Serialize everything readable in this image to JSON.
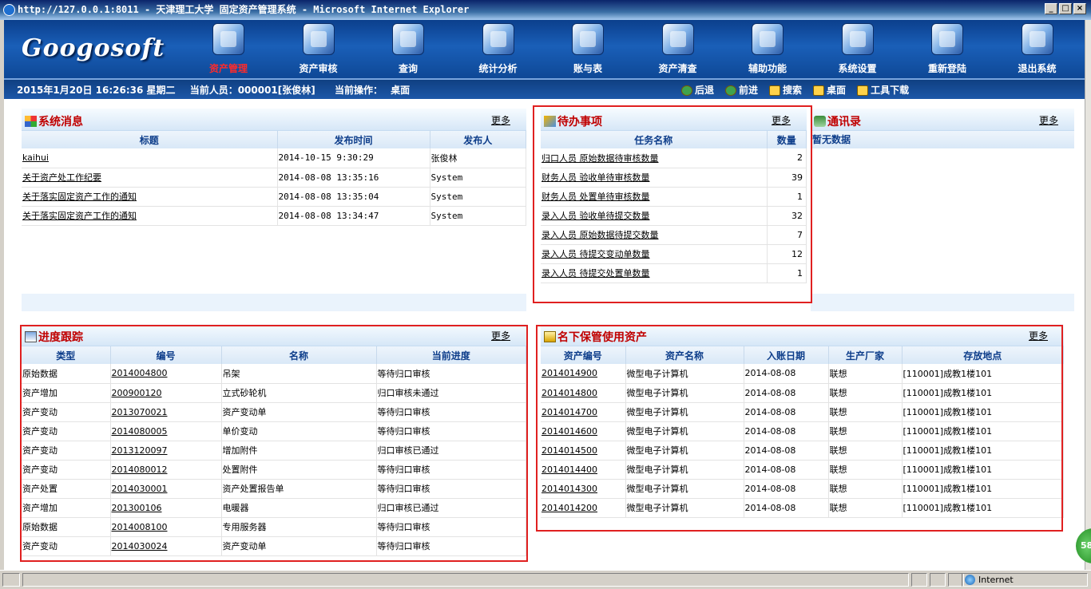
{
  "window": {
    "title": "http://127.0.0.1:8011 - 天津理工大学 固定资产管理系统 - Microsoft Internet Explorer",
    "controls": [
      "_",
      "□",
      "×"
    ]
  },
  "header": {
    "logo": "Googosoft",
    "nav": [
      {
        "label": "资产管理",
        "icon": "asset-management-icon",
        "active": true
      },
      {
        "label": "资产审核",
        "icon": "asset-audit-icon"
      },
      {
        "label": "查询",
        "icon": "query-icon"
      },
      {
        "label": "统计分析",
        "icon": "statistics-icon"
      },
      {
        "label": "账与表",
        "icon": "ledger-icon"
      },
      {
        "label": "资产清查",
        "icon": "inventory-check-icon"
      },
      {
        "label": "辅助功能",
        "icon": "auxiliary-icon"
      },
      {
        "label": "系统设置",
        "icon": "system-settings-icon"
      },
      {
        "label": "重新登陆",
        "icon": "relogin-icon"
      },
      {
        "label": "退出系统",
        "icon": "exit-icon"
      }
    ]
  },
  "status": {
    "datetime": "2015年1月20日 16:26:36 星期二",
    "user_label": "当前人员：000001[张俊林]",
    "op_label": "当前操作：",
    "op_value": "桌面",
    "tools": [
      "后退",
      "前进",
      "搜索",
      "桌面",
      "工具下载"
    ]
  },
  "messages": {
    "title": "系统消息",
    "more": "更多",
    "columns": [
      "标题",
      "发布时间",
      "发布人"
    ],
    "rows": [
      [
        "kaihui",
        "2014-10-15 9:30:29",
        "张俊林"
      ],
      [
        "关于资产处工作纪要",
        "2014-08-08 13:35:16",
        "System"
      ],
      [
        "关于落实固定资产工作的通知",
        "2014-08-08 13:35:04",
        "System"
      ],
      [
        "关于落实固定资产工作的通知",
        "2014-08-08 13:34:47",
        "System"
      ]
    ]
  },
  "todo": {
    "title": "待办事项",
    "more": "更多",
    "columns": [
      "任务名称",
      "数量"
    ],
    "rows": [
      [
        "归口人员 原始数据待审核数量",
        "2"
      ],
      [
        "财务人员 验收单待审核数量",
        "39"
      ],
      [
        "财务人员 处置单待审核数量",
        "1"
      ],
      [
        "录入人员 验收单待提交数量",
        "32"
      ],
      [
        "录入人员 原始数据待提交数量",
        "7"
      ],
      [
        "录入人员 待提交变动单数量",
        "12"
      ],
      [
        "录入人员 待提交处置单数量",
        "1"
      ]
    ]
  },
  "contacts": {
    "title": "通讯录",
    "more": "更多",
    "empty": "暂无数据"
  },
  "progress": {
    "title": "进度跟踪",
    "more": "更多",
    "columns": [
      "类型",
      "编号",
      "名称",
      "当前进度"
    ],
    "rows": [
      [
        "原始数据",
        "2014004800",
        "吊架",
        "等待归口审核"
      ],
      [
        "资产增加",
        "200900120",
        "立式砂轮机",
        "归口审核未通过"
      ],
      [
        "资产变动",
        "2013070021",
        "资产变动单",
        "等待归口审核"
      ],
      [
        "资产变动",
        "2014080005",
        "单价变动",
        "等待归口审核"
      ],
      [
        "资产变动",
        "2013120097",
        "增加附件",
        "归口审核已通过"
      ],
      [
        "资产变动",
        "2014080012",
        "处置附件",
        "等待归口审核"
      ],
      [
        "资产处置",
        "2014030001",
        "资产处置报告单",
        "等待归口审核"
      ],
      [
        "资产增加",
        "201300106",
        "电暖器",
        "归口审核已通过"
      ],
      [
        "原始数据",
        "2014008100",
        "专用服务器",
        "等待归口审核"
      ],
      [
        "资产变动",
        "2014030024",
        "资产变动单",
        "等待归口审核"
      ]
    ]
  },
  "assets": {
    "title": "名下保管使用资产",
    "more": "更多",
    "columns": [
      "资产编号",
      "资产名称",
      "入账日期",
      "生产厂家",
      "存放地点"
    ],
    "rows": [
      [
        "2014014900",
        "微型电子计算机",
        "2014-08-08",
        "联想",
        "[110001]成教1楼101"
      ],
      [
        "2014014800",
        "微型电子计算机",
        "2014-08-08",
        "联想",
        "[110001]成教1楼101"
      ],
      [
        "2014014700",
        "微型电子计算机",
        "2014-08-08",
        "联想",
        "[110001]成教1楼101"
      ],
      [
        "2014014600",
        "微型电子计算机",
        "2014-08-08",
        "联想",
        "[110001]成教1楼101"
      ],
      [
        "2014014500",
        "微型电子计算机",
        "2014-08-08",
        "联想",
        "[110001]成教1楼101"
      ],
      [
        "2014014400",
        "微型电子计算机",
        "2014-08-08",
        "联想",
        "[110001]成教1楼101"
      ],
      [
        "2014014300",
        "微型电子计算机",
        "2014-08-08",
        "联想",
        "[110001]成教1楼101"
      ],
      [
        "2014014200",
        "微型电子计算机",
        "2014-08-08",
        "联想",
        "[110001]成教1楼101"
      ]
    ]
  },
  "statusbar": {
    "zone": "Internet",
    "badge": "58"
  },
  "colors": {
    "highlight": "#e02020",
    "panel_title": "#c00000",
    "header_blue": "#1a5fb8"
  }
}
